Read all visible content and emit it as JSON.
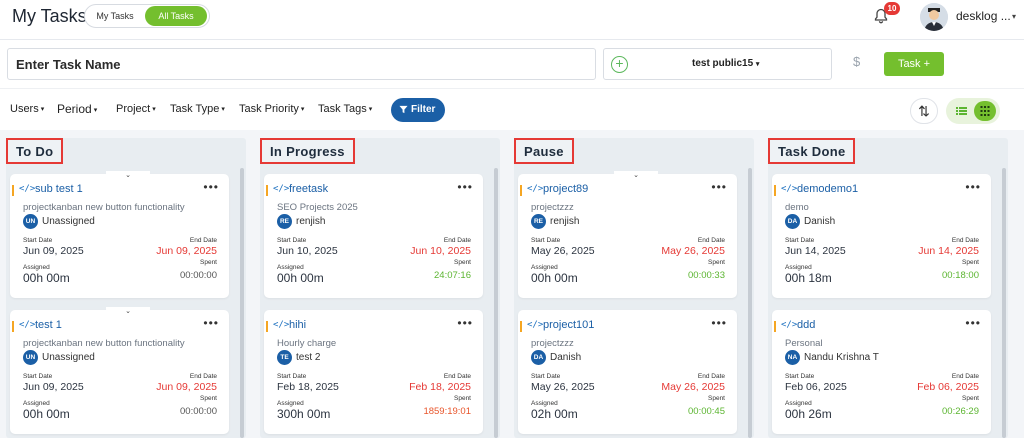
{
  "header": {
    "title": "My Tasks",
    "toggle": {
      "mine": "My Tasks",
      "all": "All Tasks"
    },
    "notifications": "10",
    "username": "desklog ..."
  },
  "task_entry": {
    "placeholder": "Enter Task Name",
    "project": "test public15",
    "currency_symbol": "$",
    "add_label": "Task +"
  },
  "filters": {
    "users": "Users",
    "period": "Period",
    "project": "Project",
    "task_type": "Task Type",
    "task_priority": "Task Priority",
    "task_tags": "Task Tags",
    "filter_button": "Filter"
  },
  "labels": {
    "start_date": "Start Date",
    "end_date": "End Date",
    "assigned": "Assigned",
    "spent": "Spent"
  },
  "colors": {
    "brand_green": "#74bf2e",
    "brand_blue": "#1b5fa6",
    "danger_red": "#e53935",
    "accent_orange": "#f5a623"
  },
  "columns": [
    {
      "title": "To Do",
      "cards": [
        {
          "name": "sub test 1",
          "desc": "projectkanban new button functionality",
          "initials": "UN",
          "person": "Unassigned",
          "start": "Jun 09, 2025",
          "end": "Jun 09, 2025",
          "assigned": "00h 00m",
          "spent": "00:00:00"
        },
        {
          "name": "test 1",
          "desc": "projectkanban new button functionality",
          "initials": "UN",
          "person": "Unassigned",
          "start": "Jun 09, 2025",
          "end": "Jun 09, 2025",
          "assigned": "00h 00m",
          "spent": "00:00:00"
        }
      ]
    },
    {
      "title": "In Progress",
      "cards": [
        {
          "name": "freetask",
          "desc": "SEO Projects 2025",
          "initials": "RE",
          "person": "renjish",
          "start": "Jun 10, 2025",
          "end": "Jun 10, 2025",
          "assigned": "00h 00m",
          "spent": "24:07:16"
        },
        {
          "name": "hihi",
          "desc": "Hourly charge",
          "initials": "TE",
          "person": "test 2",
          "start": "Feb 18, 2025",
          "end": "Feb 18, 2025",
          "assigned": "300h 00m",
          "spent": "1859:19:01"
        }
      ]
    },
    {
      "title": "Pause",
      "cards": [
        {
          "name": "project89",
          "desc": "projectzzz",
          "initials": "RE",
          "person": "renjish",
          "start": "May 26, 2025",
          "end": "May 26, 2025",
          "assigned": "00h 00m",
          "spent": "00:00:33"
        },
        {
          "name": "project101",
          "desc": "projectzzz",
          "initials": "DA",
          "person": "Danish",
          "start": "May 26, 2025",
          "end": "May 26, 2025",
          "assigned": "02h 00m",
          "spent": "00:00:45"
        }
      ]
    },
    {
      "title": "Task Done",
      "cards": [
        {
          "name": "demodemo1",
          "desc": "demo",
          "initials": "DA",
          "person": "Danish",
          "start": "Jun 14, 2025",
          "end": "Jun 14, 2025",
          "assigned": "00h 18m",
          "spent": "00:18:00"
        },
        {
          "name": "ddd",
          "desc": "Personal",
          "initials": "NA",
          "person": "Nandu Krishna T",
          "start": "Feb 06, 2025",
          "end": "Feb 06, 2025",
          "assigned": "00h 26m",
          "spent": "00:26:29"
        }
      ]
    }
  ]
}
